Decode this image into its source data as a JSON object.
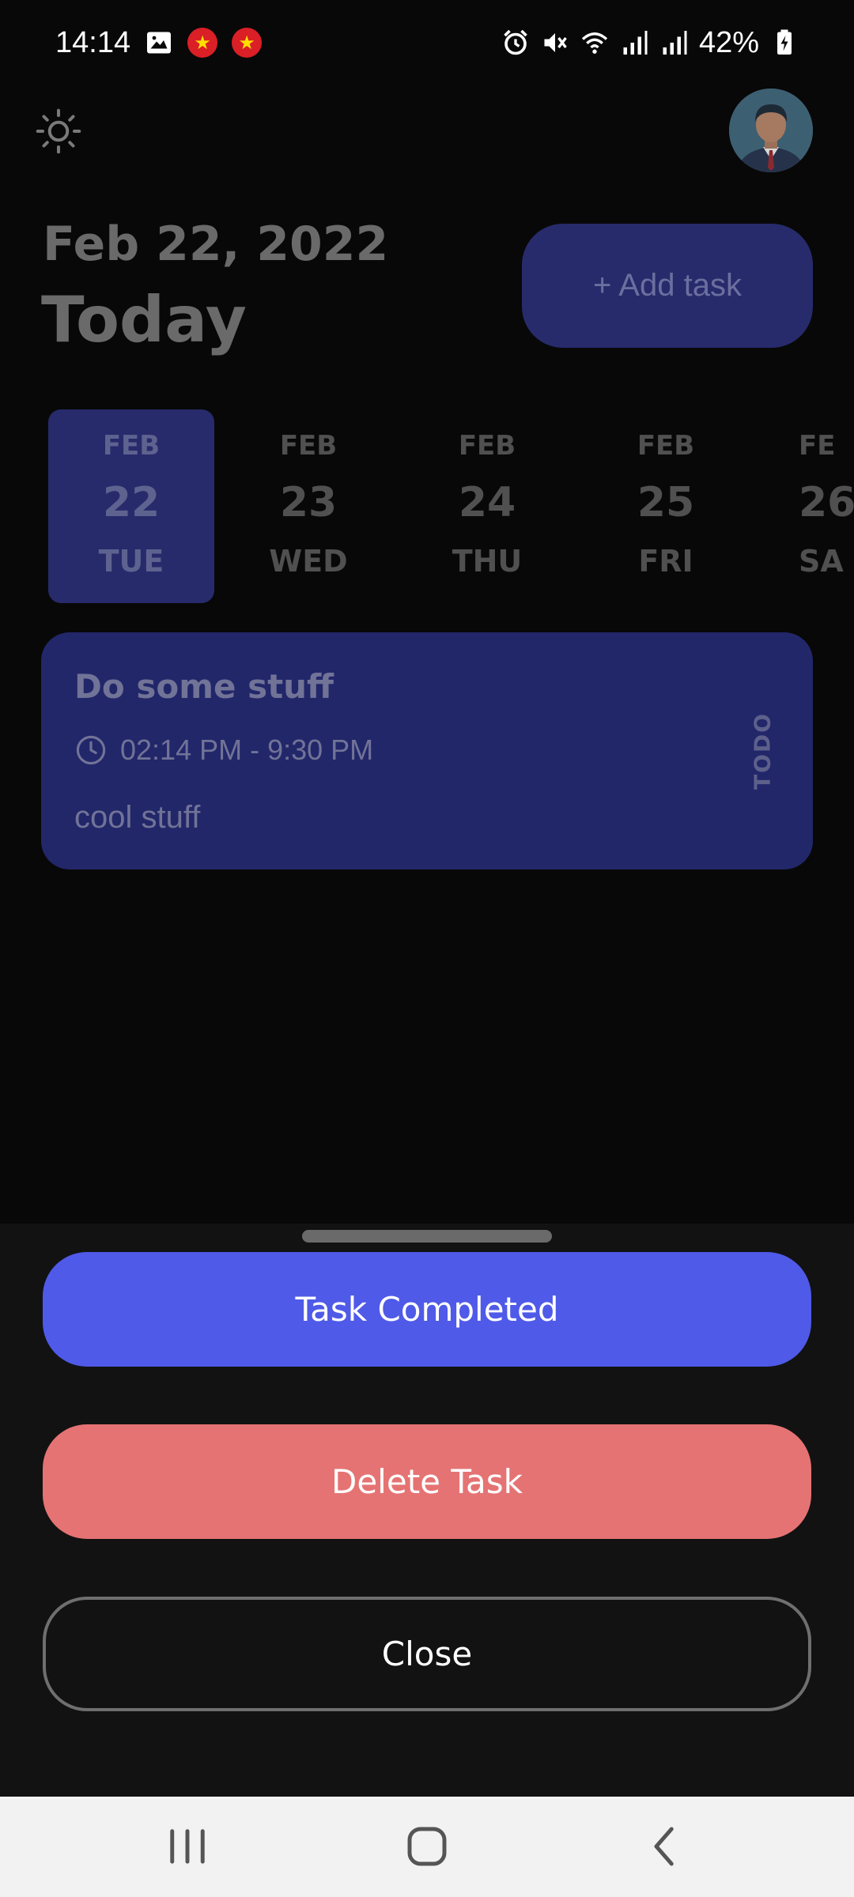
{
  "status_bar": {
    "time": "14:14",
    "battery": "42%",
    "icons": [
      "image-icon",
      "flag-badge",
      "flag-badge",
      "alarm-icon",
      "mute-icon",
      "wifi-icon",
      "signal-icon",
      "signal-icon",
      "battery-charging-icon"
    ]
  },
  "header": {
    "date": "Feb 22, 2022",
    "title": "Today",
    "add_task_label": "+ Add task"
  },
  "date_strip": [
    {
      "month": "FEB",
      "day": "22",
      "weekday": "TUE",
      "selected": true
    },
    {
      "month": "FEB",
      "day": "23",
      "weekday": "WED",
      "selected": false
    },
    {
      "month": "FEB",
      "day": "24",
      "weekday": "THU",
      "selected": false
    },
    {
      "month": "FEB",
      "day": "25",
      "weekday": "FRI",
      "selected": false
    },
    {
      "month": "FE",
      "day": "26",
      "weekday": "SA",
      "selected": false
    }
  ],
  "task": {
    "title": "Do some stuff",
    "time": "02:14 PM - 9:30 PM",
    "description": "cool stuff",
    "status": "TODO"
  },
  "sheet": {
    "complete_label": "Task Completed",
    "delete_label": "Delete Task",
    "close_label": "Close"
  },
  "colors": {
    "accent": "#4f5ae8",
    "danger": "#e57373",
    "card": "#22276a",
    "background": "#080808"
  }
}
